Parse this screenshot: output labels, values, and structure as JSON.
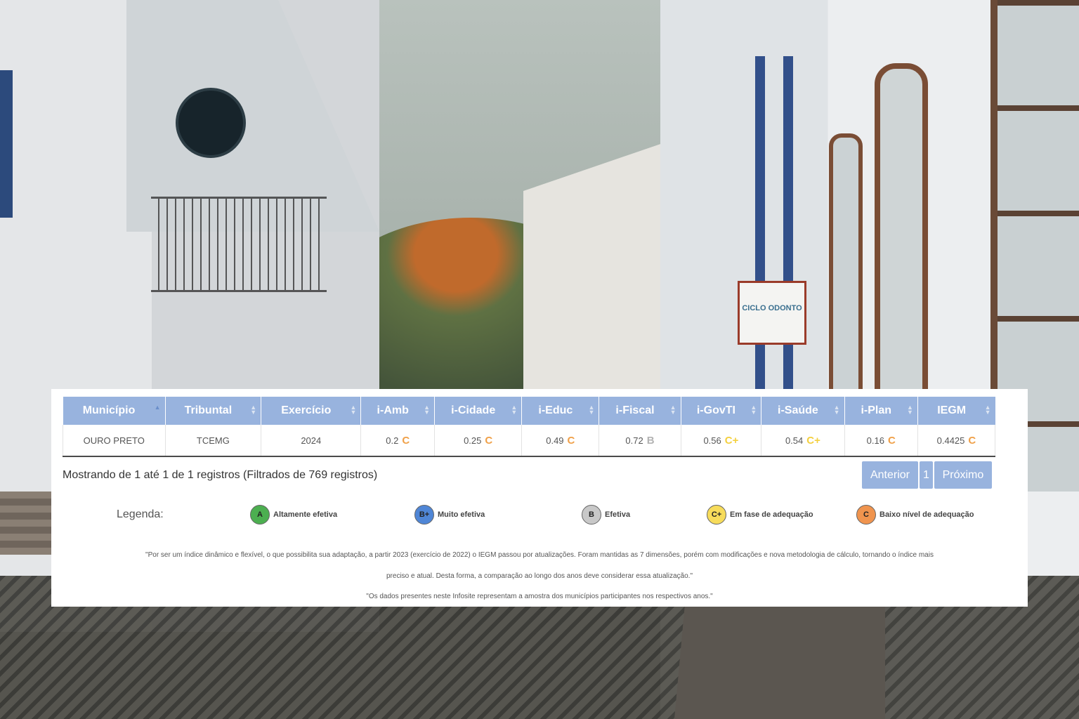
{
  "table": {
    "headers": [
      "Município",
      "Tribuntal",
      "Exercício",
      "i-Amb",
      "i-Cidade",
      "i-Educ",
      "i-Fiscal",
      "i-GovTI",
      "i-Saúde",
      "i-Plan",
      "IEGM"
    ],
    "row": {
      "municipio": "OURO PRETO",
      "tribunal": "TCEMG",
      "exercicio": "2024",
      "i_amb": {
        "value": "0.2",
        "grade": "C"
      },
      "i_cidade": {
        "value": "0.25",
        "grade": "C"
      },
      "i_educ": {
        "value": "0.49",
        "grade": "C"
      },
      "i_fiscal": {
        "value": "0.72",
        "grade": "B"
      },
      "i_govti": {
        "value": "0.56",
        "grade": "C+"
      },
      "i_saude": {
        "value": "0.54",
        "grade": "C+"
      },
      "i_plan": {
        "value": "0.16",
        "grade": "C"
      },
      "iegm": {
        "value": "0.4425",
        "grade": "C"
      }
    }
  },
  "info": "Mostrando de 1 até 1 de 1 registros (Filtrados de 769 registros)",
  "pager": {
    "prev": "Anterior",
    "page": "1",
    "next": "Próximo"
  },
  "legend": {
    "label": "Legenda:",
    "items": [
      {
        "badge": "A",
        "text": "Altamente efetiva",
        "color": "#4caf50"
      },
      {
        "badge": "B+",
        "text": "Muito efetiva",
        "color": "#4f86d6"
      },
      {
        "badge": "B",
        "text": "Efetiva",
        "color": "#c8c8c8"
      },
      {
        "badge": "C+",
        "text": "Em fase de adequação",
        "color": "#f7dc5b"
      },
      {
        "badge": "C",
        "text": "Baixo nível de adequação",
        "color": "#f0944e"
      }
    ]
  },
  "notes": {
    "line1": "\"Por ser um índice dinâmico e flexível, o que possibilita sua adaptação, a partir 2023 (exercício de 2022) o IEGM passou por atualizações. Foram mantidas as 7 dimensões, porém com modificações e nova metodologia de cálculo, tornando o índice mais",
    "line2": "preciso e atual. Desta forma, a comparação ao longo dos anos deve considerar essa atualização.\"",
    "line3": "\"Os dados presentes neste Infosite representam a amostra dos municípios participantes nos respectivos anos.\""
  },
  "background": {
    "sign_text": "CICLO ODONTO"
  }
}
